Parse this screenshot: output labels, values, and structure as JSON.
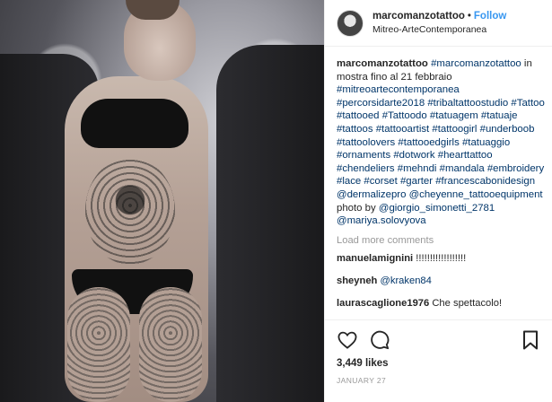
{
  "header": {
    "username": "marcomanzotattoo",
    "separator": "•",
    "follow_label": "Follow",
    "location": "Mitreo-ArteContemporanea"
  },
  "caption": {
    "username": "marcomanzotattoo",
    "mention_self": "#marcomanzotattoo",
    "text1": " in mostra fino al 21 febbraio ",
    "tags": [
      "#mitreoartecontemporanea",
      "#percorsidarte2018",
      "#tribaltattoostudio",
      "#Tattoo",
      "#tattooed",
      "#Tattoodo",
      "#tatuagem",
      "#tatuaje",
      "#tattoos",
      "#tattooartist",
      "#tattoogirl",
      "#underboob",
      "#tattoolovers",
      "#tattooedgirls",
      "#tatuaggio",
      "#ornaments",
      "#dotwork",
      "#hearttattoo",
      "#chendeliers",
      "#mehndi",
      "#mandala",
      "#embroidery",
      "#lace",
      "#corset",
      "#garter",
      "#francescabonidesign"
    ],
    "mention1": "@dermalizepro",
    "mention2": "@cheyenne_tattooequipment",
    "text2": " photo by ",
    "mention3": "@giorgio_simonetti_2781",
    "mention4": "@mariya.solovyova"
  },
  "load_more": "Load more comments",
  "comments": [
    {
      "user": "manuelamignini",
      "text": " !!!!!!!!!!!!!!!!!!",
      "mention": ""
    },
    {
      "user": "sheyneh",
      "text": " ",
      "mention": "@kraken84"
    },
    {
      "user": "laurascaglione1976",
      "text": " Che spettacolo!",
      "mention": ""
    }
  ],
  "actions": {
    "like_icon": "heart-icon",
    "comment_icon": "comment-icon",
    "save_icon": "bookmark-icon"
  },
  "likes": "3,449 likes",
  "date": "JANUARY 27",
  "colors": {
    "link": "#003569",
    "follow": "#3897f0",
    "muted": "#999999"
  }
}
